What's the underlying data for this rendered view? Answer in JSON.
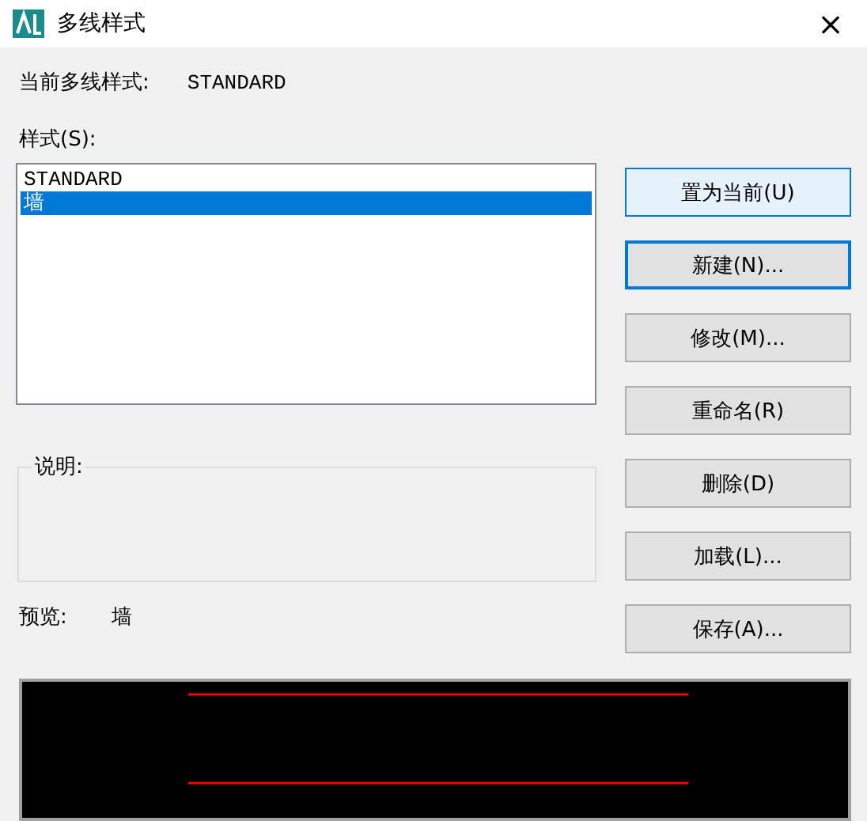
{
  "window": {
    "title": "多线样式",
    "close": "×"
  },
  "current_style": {
    "label": "当前多线样式:",
    "value": "STANDARD"
  },
  "styles": {
    "label": "样式(S):",
    "items": [
      {
        "name": "STANDARD",
        "selected": false
      },
      {
        "name": "墙",
        "selected": true
      }
    ]
  },
  "description": {
    "label": "说明:"
  },
  "preview": {
    "label": "预览:",
    "value": "墙"
  },
  "buttons": [
    {
      "label": "置为当前(U)",
      "hovered": true,
      "focused": false
    },
    {
      "label": "新建(N)...",
      "hovered": false,
      "focused": true
    },
    {
      "label": "修改(M)...",
      "hovered": false,
      "focused": false
    },
    {
      "label": "重命名(R)",
      "hovered": false,
      "focused": false
    },
    {
      "label": "删除(D)",
      "hovered": false,
      "focused": false
    },
    {
      "label": "加载(L)...",
      "hovered": false,
      "focused": false
    },
    {
      "label": "保存(A)...",
      "hovered": false,
      "focused": false
    }
  ]
}
